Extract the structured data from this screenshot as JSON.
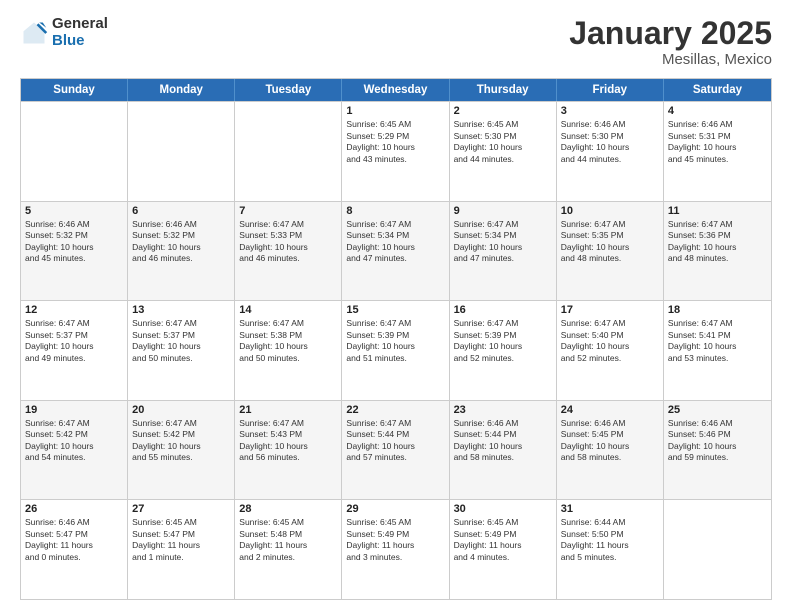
{
  "header": {
    "logo_general": "General",
    "logo_blue": "Blue",
    "title": "January 2025",
    "location": "Mesillas, Mexico"
  },
  "calendar": {
    "days_of_week": [
      "Sunday",
      "Monday",
      "Tuesday",
      "Wednesday",
      "Thursday",
      "Friday",
      "Saturday"
    ],
    "rows": [
      {
        "alt": false,
        "cells": [
          {
            "day": "",
            "info": ""
          },
          {
            "day": "",
            "info": ""
          },
          {
            "day": "",
            "info": ""
          },
          {
            "day": "1",
            "info": "Sunrise: 6:45 AM\nSunset: 5:29 PM\nDaylight: 10 hours\nand 43 minutes."
          },
          {
            "day": "2",
            "info": "Sunrise: 6:45 AM\nSunset: 5:30 PM\nDaylight: 10 hours\nand 44 minutes."
          },
          {
            "day": "3",
            "info": "Sunrise: 6:46 AM\nSunset: 5:30 PM\nDaylight: 10 hours\nand 44 minutes."
          },
          {
            "day": "4",
            "info": "Sunrise: 6:46 AM\nSunset: 5:31 PM\nDaylight: 10 hours\nand 45 minutes."
          }
        ]
      },
      {
        "alt": true,
        "cells": [
          {
            "day": "5",
            "info": "Sunrise: 6:46 AM\nSunset: 5:32 PM\nDaylight: 10 hours\nand 45 minutes."
          },
          {
            "day": "6",
            "info": "Sunrise: 6:46 AM\nSunset: 5:32 PM\nDaylight: 10 hours\nand 46 minutes."
          },
          {
            "day": "7",
            "info": "Sunrise: 6:47 AM\nSunset: 5:33 PM\nDaylight: 10 hours\nand 46 minutes."
          },
          {
            "day": "8",
            "info": "Sunrise: 6:47 AM\nSunset: 5:34 PM\nDaylight: 10 hours\nand 47 minutes."
          },
          {
            "day": "9",
            "info": "Sunrise: 6:47 AM\nSunset: 5:34 PM\nDaylight: 10 hours\nand 47 minutes."
          },
          {
            "day": "10",
            "info": "Sunrise: 6:47 AM\nSunset: 5:35 PM\nDaylight: 10 hours\nand 48 minutes."
          },
          {
            "day": "11",
            "info": "Sunrise: 6:47 AM\nSunset: 5:36 PM\nDaylight: 10 hours\nand 48 minutes."
          }
        ]
      },
      {
        "alt": false,
        "cells": [
          {
            "day": "12",
            "info": "Sunrise: 6:47 AM\nSunset: 5:37 PM\nDaylight: 10 hours\nand 49 minutes."
          },
          {
            "day": "13",
            "info": "Sunrise: 6:47 AM\nSunset: 5:37 PM\nDaylight: 10 hours\nand 50 minutes."
          },
          {
            "day": "14",
            "info": "Sunrise: 6:47 AM\nSunset: 5:38 PM\nDaylight: 10 hours\nand 50 minutes."
          },
          {
            "day": "15",
            "info": "Sunrise: 6:47 AM\nSunset: 5:39 PM\nDaylight: 10 hours\nand 51 minutes."
          },
          {
            "day": "16",
            "info": "Sunrise: 6:47 AM\nSunset: 5:39 PM\nDaylight: 10 hours\nand 52 minutes."
          },
          {
            "day": "17",
            "info": "Sunrise: 6:47 AM\nSunset: 5:40 PM\nDaylight: 10 hours\nand 52 minutes."
          },
          {
            "day": "18",
            "info": "Sunrise: 6:47 AM\nSunset: 5:41 PM\nDaylight: 10 hours\nand 53 minutes."
          }
        ]
      },
      {
        "alt": true,
        "cells": [
          {
            "day": "19",
            "info": "Sunrise: 6:47 AM\nSunset: 5:42 PM\nDaylight: 10 hours\nand 54 minutes."
          },
          {
            "day": "20",
            "info": "Sunrise: 6:47 AM\nSunset: 5:42 PM\nDaylight: 10 hours\nand 55 minutes."
          },
          {
            "day": "21",
            "info": "Sunrise: 6:47 AM\nSunset: 5:43 PM\nDaylight: 10 hours\nand 56 minutes."
          },
          {
            "day": "22",
            "info": "Sunrise: 6:47 AM\nSunset: 5:44 PM\nDaylight: 10 hours\nand 57 minutes."
          },
          {
            "day": "23",
            "info": "Sunrise: 6:46 AM\nSunset: 5:44 PM\nDaylight: 10 hours\nand 58 minutes."
          },
          {
            "day": "24",
            "info": "Sunrise: 6:46 AM\nSunset: 5:45 PM\nDaylight: 10 hours\nand 58 minutes."
          },
          {
            "day": "25",
            "info": "Sunrise: 6:46 AM\nSunset: 5:46 PM\nDaylight: 10 hours\nand 59 minutes."
          }
        ]
      },
      {
        "alt": false,
        "cells": [
          {
            "day": "26",
            "info": "Sunrise: 6:46 AM\nSunset: 5:47 PM\nDaylight: 11 hours\nand 0 minutes."
          },
          {
            "day": "27",
            "info": "Sunrise: 6:45 AM\nSunset: 5:47 PM\nDaylight: 11 hours\nand 1 minute."
          },
          {
            "day": "28",
            "info": "Sunrise: 6:45 AM\nSunset: 5:48 PM\nDaylight: 11 hours\nand 2 minutes."
          },
          {
            "day": "29",
            "info": "Sunrise: 6:45 AM\nSunset: 5:49 PM\nDaylight: 11 hours\nand 3 minutes."
          },
          {
            "day": "30",
            "info": "Sunrise: 6:45 AM\nSunset: 5:49 PM\nDaylight: 11 hours\nand 4 minutes."
          },
          {
            "day": "31",
            "info": "Sunrise: 6:44 AM\nSunset: 5:50 PM\nDaylight: 11 hours\nand 5 minutes."
          },
          {
            "day": "",
            "info": ""
          }
        ]
      }
    ]
  }
}
